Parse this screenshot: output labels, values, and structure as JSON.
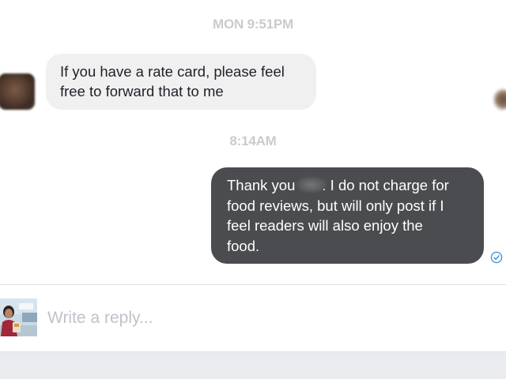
{
  "conversation": {
    "timestamps": [
      "MON 9:51PM",
      "8:14AM"
    ],
    "messages": [
      {
        "direction": "incoming",
        "lines": [
          "If you have a rate card, please feel",
          "free to forward that to me"
        ]
      },
      {
        "direction": "outgoing",
        "line1_prefix": "Thank you",
        "line1_suffix": ". I do not charge for",
        "lines_rest": [
          "food reviews, but will only post if I",
          "feel readers will also enjoy the",
          "food."
        ],
        "status_icon": "seen-check-icon"
      }
    ]
  },
  "composer": {
    "placeholder": "Write a reply..."
  },
  "colors": {
    "incoming_bubble": "#f1f0f0",
    "outgoing_bubble": "#4b4c4f",
    "timestamp": "#c9cbcf",
    "seen_icon": "#3b8ed8"
  }
}
